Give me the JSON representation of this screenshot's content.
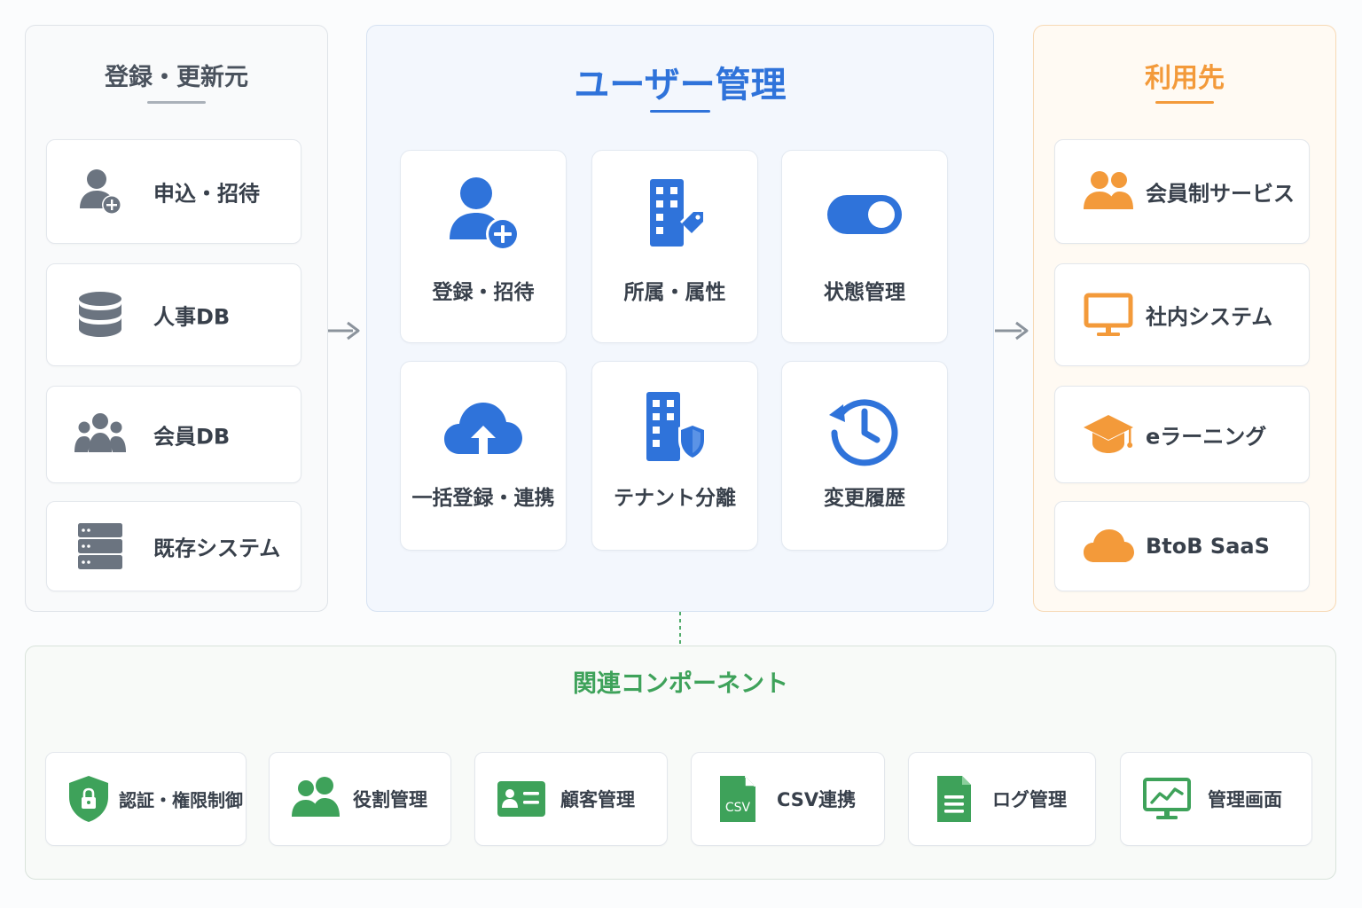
{
  "left": {
    "title": "登録・更新元",
    "items": [
      {
        "label": "申込・招待",
        "icon": "user-add-icon"
      },
      {
        "label": "人事DB",
        "icon": "database-icon"
      },
      {
        "label": "会員DB",
        "icon": "group-icon"
      },
      {
        "label": "既存システム",
        "icon": "server-icon"
      }
    ]
  },
  "center": {
    "title": "ユーザー管理",
    "items": [
      {
        "label": "登録・招待",
        "icon": "user-add-icon"
      },
      {
        "label": "所属・属性",
        "icon": "building-tag-icon"
      },
      {
        "label": "状態管理",
        "icon": "toggle-icon"
      },
      {
        "label": "一括登録・連携",
        "icon": "cloud-upload-icon"
      },
      {
        "label": "テナント分離",
        "icon": "building-shield-icon"
      },
      {
        "label": "変更履歴",
        "icon": "history-icon"
      }
    ]
  },
  "right": {
    "title": "利用先",
    "items": [
      {
        "label": "会員制サービス",
        "icon": "people-icon"
      },
      {
        "label": "社内システム",
        "icon": "monitor-icon"
      },
      {
        "label": "eラーニング",
        "icon": "graduation-cap-icon"
      },
      {
        "label": "BtoB SaaS",
        "icon": "cloud-icon"
      }
    ]
  },
  "bottom": {
    "title": "関連コンポーネント",
    "items": [
      {
        "label": "認証・権限制御",
        "icon": "shield-lock-icon"
      },
      {
        "label": "役割管理",
        "icon": "people-icon"
      },
      {
        "label": "顧客管理",
        "icon": "id-card-icon"
      },
      {
        "label": "CSV連携",
        "icon": "csv-file-icon"
      },
      {
        "label": "ログ管理",
        "icon": "document-icon"
      },
      {
        "label": "管理画面",
        "icon": "monitor-chart-icon"
      }
    ],
    "csv_badge": "CSV"
  },
  "colors": {
    "left_accent": "#6b7480",
    "center_accent": "#2f73da",
    "right_accent": "#f39a3a",
    "bottom_accent": "#3ea25a",
    "arrow": "#8b939c"
  }
}
